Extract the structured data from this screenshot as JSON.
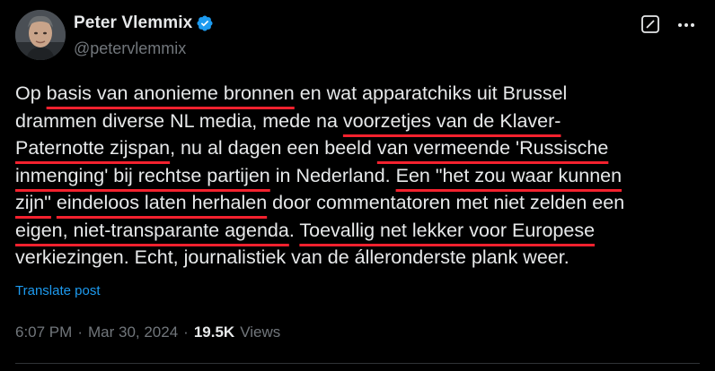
{
  "author": {
    "display_name": "Peter Vlemmix",
    "handle": "@petervlemmix",
    "verified": true,
    "avatar_icon": "person-portrait",
    "verified_icon": "verified-badge-icon"
  },
  "header_icons": {
    "grok": "grok-icon",
    "more": "more-options-icon"
  },
  "body_lines": [
    [
      {
        "text": "Op "
      },
      {
        "text": "basis van anonieme bronnen",
        "underline": true
      },
      {
        "text": " en wat apparatchiks uit Brussel"
      }
    ],
    [
      {
        "text": "drammen diverse NL media, mede na "
      },
      {
        "text": "voorzetjes van de Klaver-",
        "underline": true
      }
    ],
    [
      {
        "text": "Paternotte zijspan",
        "underline": true
      },
      {
        "text": ", nu al dagen een beeld "
      },
      {
        "text": "van vermeende 'Russische",
        "underline": true
      }
    ],
    [
      {
        "text": "inmenging' bij rechtse partijen",
        "underline": true
      },
      {
        "text": " in Nederland. "
      },
      {
        "text": "Een \"het zou waar kunnen",
        "underline": true
      }
    ],
    [
      {
        "text": "zijn\"",
        "underline": true
      },
      {
        "text": " "
      },
      {
        "text": "eindeloos laten herhalen",
        "underline": true
      },
      {
        "text": " door commentatoren met niet zelden een"
      }
    ],
    [
      {
        "text": "eigen, niet-transparante agenda",
        "underline": true
      },
      {
        "text": ". "
      },
      {
        "text": "Toevallig net lekker voor Europese",
        "underline": true
      }
    ],
    [
      {
        "text": "verkiezingen. Echt, journalistiek van de álleronderste plank weer."
      }
    ]
  ],
  "translate_label": "Translate post",
  "meta": {
    "time": "6:07 PM",
    "separator": "·",
    "date": "Mar 30, 2024",
    "separator2": "·",
    "views_count": "19.5K",
    "views_label": "Views"
  },
  "colors": {
    "background": "#000000",
    "text": "#e7e9ea",
    "muted": "#71767b",
    "link": "#1d9bf0",
    "underline": "#f4212e",
    "verified": "#1d9bf0"
  }
}
